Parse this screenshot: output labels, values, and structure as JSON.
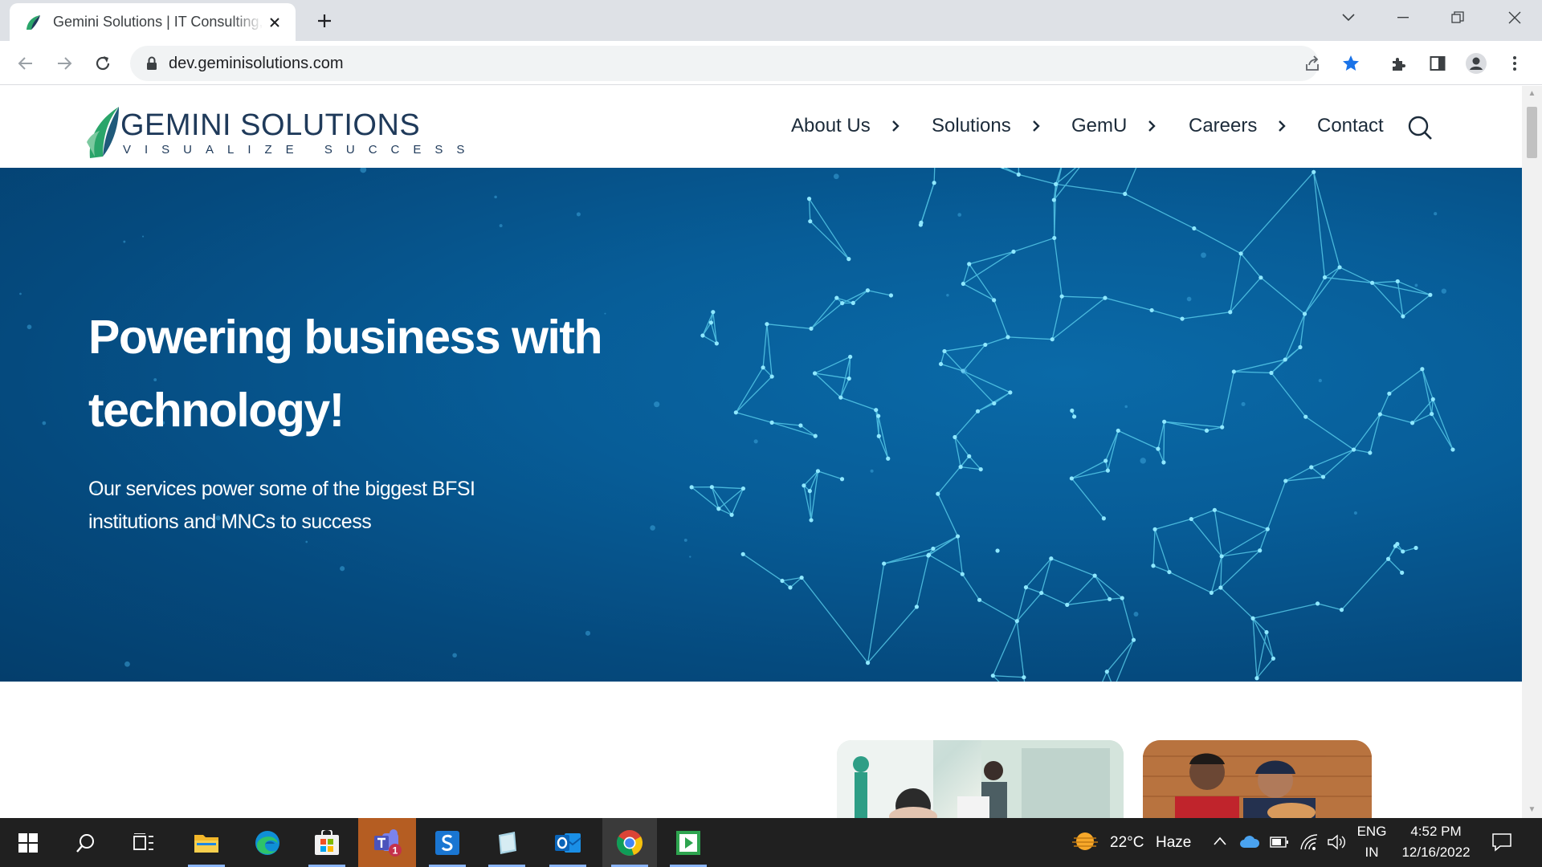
{
  "browser": {
    "tab_title": "Gemini Solutions | IT Consulting, Software Development",
    "url": "dev.geminisolutions.com"
  },
  "site": {
    "logo_name_bold": "GEMINI",
    "logo_name_rest": " SOLUTIONS",
    "logo_tagline": "VISUALIZE SUCCESS",
    "nav": [
      {
        "label": "About Us"
      },
      {
        "label": "Solutions"
      },
      {
        "label": "GemU"
      },
      {
        "label": "Careers"
      },
      {
        "label": "Contact"
      }
    ],
    "hero": {
      "title_line1": "Powering business with",
      "title_line2": "technology!",
      "subtitle_line1": "Our services power some of the biggest BFSI",
      "subtitle_line2": "institutions and MNCs to success"
    }
  },
  "taskbar": {
    "weather_temp": "22°C",
    "weather_desc": "Haze",
    "lang_line1": "ENG",
    "lang_line2": "IN",
    "time": "4:52 PM",
    "date": "12/16/2022",
    "teams_badge": "1"
  },
  "colors": {
    "accent_blue": "#1a73e8",
    "hero_bg": "#075d98",
    "logo_navy": "#1f3a5a",
    "logo_green": "#2aa56a",
    "taskbar_bg": "#202020"
  },
  "icons": [
    "back-icon",
    "forward-icon",
    "reload-icon",
    "lock-icon",
    "share-icon",
    "star-icon",
    "extensions-icon",
    "side-panel-icon",
    "profile-icon",
    "menu-icon",
    "search-icon",
    "windows-start-icon",
    "taskbar-search-icon",
    "task-view-icon",
    "file-explorer-icon",
    "edge-icon",
    "store-icon",
    "teams-icon",
    "skype-business-icon",
    "notes-icon",
    "outlook-icon",
    "chrome-icon",
    "media-icon",
    "weather-icon",
    "chevron-up-icon",
    "onedrive-icon",
    "battery-icon",
    "wifi-icon",
    "volume-icon",
    "notification-icon"
  ]
}
